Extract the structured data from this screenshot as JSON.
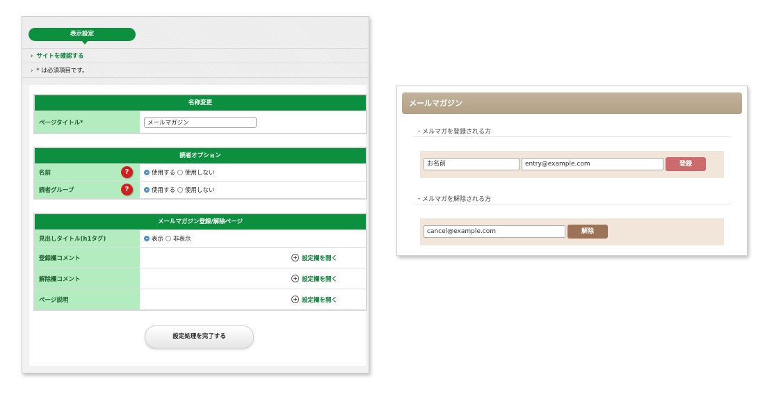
{
  "admin": {
    "title": "表示設定",
    "breadcrumb_link": "サイトを確認する",
    "required_note": "* は必須項目です。",
    "sections": {
      "rename": {
        "title": "名称変更",
        "page_title_label": "ページタイトル*",
        "page_title_value": "メールマガジン"
      },
      "reader_options": {
        "title": "読者オプション",
        "name_label": "名前",
        "group_label": "読者グループ",
        "use_label": "使用する",
        "nouse_label": "使用しない",
        "help_symbol": "?"
      },
      "page_settings": {
        "title": "メールマガジン登録/解除ページ",
        "heading_label": "見出しタイトル(h1タグ)",
        "show_label": "表示",
        "hide_label": "非表示",
        "register_comment_label": "登録欄コメント",
        "unsubscribe_comment_label": "解除欄コメント",
        "page_desc_label": "ページ説明",
        "open_settings_label": "設定欄を開く"
      }
    },
    "complete_button": "設定処理を完了する"
  },
  "widget": {
    "title": "メールマガジン",
    "register_heading": "・メルマガを登録される方",
    "name_value": "お名前",
    "email_value": "entry@example.com",
    "register_button": "登録",
    "unsubscribe_heading": "・メルマガを解除される方",
    "cancel_email_value": "cancel@example.com",
    "unsubscribe_button": "解除"
  },
  "colors": {
    "admin_green": "#0c8f3e",
    "label_green": "#b3ecbf",
    "widget_header": "#b8a88e",
    "widget_box": "#f2e6db",
    "register_button": "#cc6b6b",
    "unsubscribe_button": "#9c7356"
  }
}
